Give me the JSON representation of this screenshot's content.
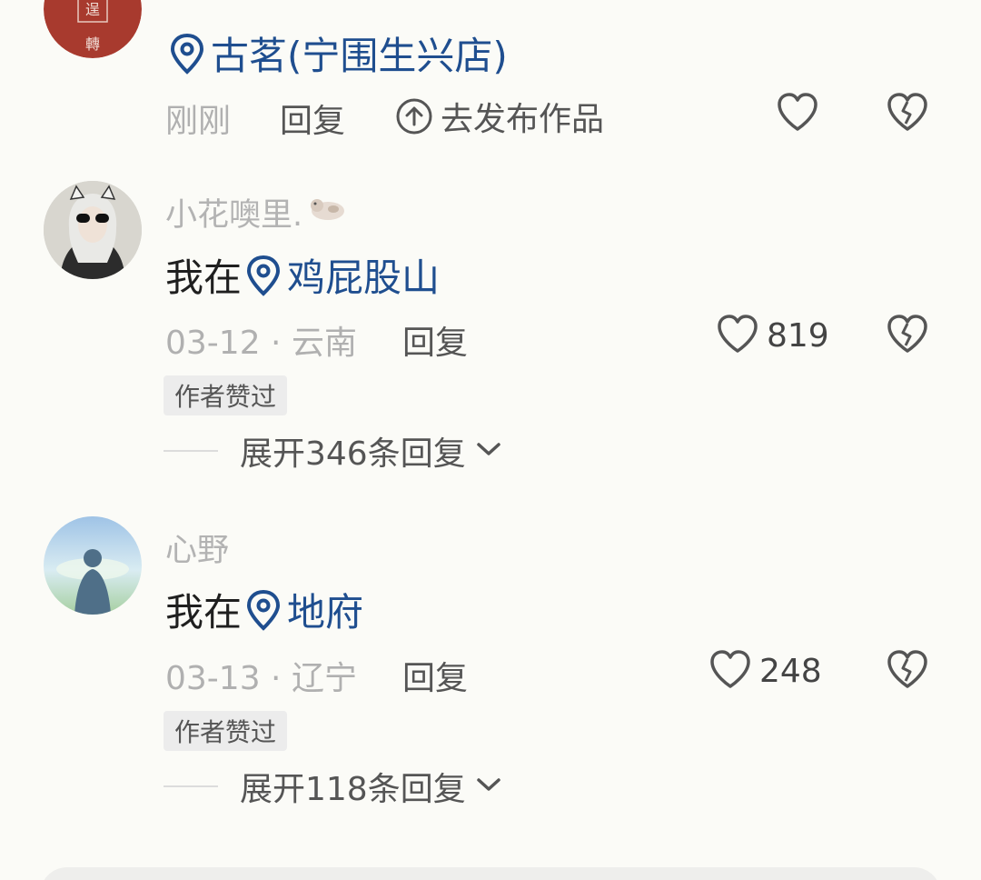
{
  "comments": [
    {
      "username": "",
      "location_name": "古茗(宁围生兴店)",
      "time": "刚刚",
      "reply_label": "回复",
      "publish_label": "去发布作品",
      "avatar_text": "巾運轉",
      "avatar_color": "#a83a2e"
    },
    {
      "username": "小花噢里.",
      "prefix": "我在",
      "location_name": "鸡屁股山",
      "time": "03-12 · 云南",
      "reply_label": "回复",
      "like_count": "819",
      "badge": "作者赞过",
      "expand_label": "展开346条回复"
    },
    {
      "username": "心野",
      "prefix": "我在",
      "location_name": "地府",
      "time": "03-13 · 辽宁",
      "reply_label": "回复",
      "like_count": "248",
      "badge": "作者赞过",
      "expand_label": "展开118条回复"
    }
  ],
  "colors": {
    "background": "#fbfbf7",
    "location": "#1f4e8f",
    "muted": "#b0b0b0"
  },
  "icons": [
    "location-pin-icon",
    "upload-circle-icon",
    "heart-icon",
    "broken-heart-icon",
    "chevron-down-icon"
  ]
}
